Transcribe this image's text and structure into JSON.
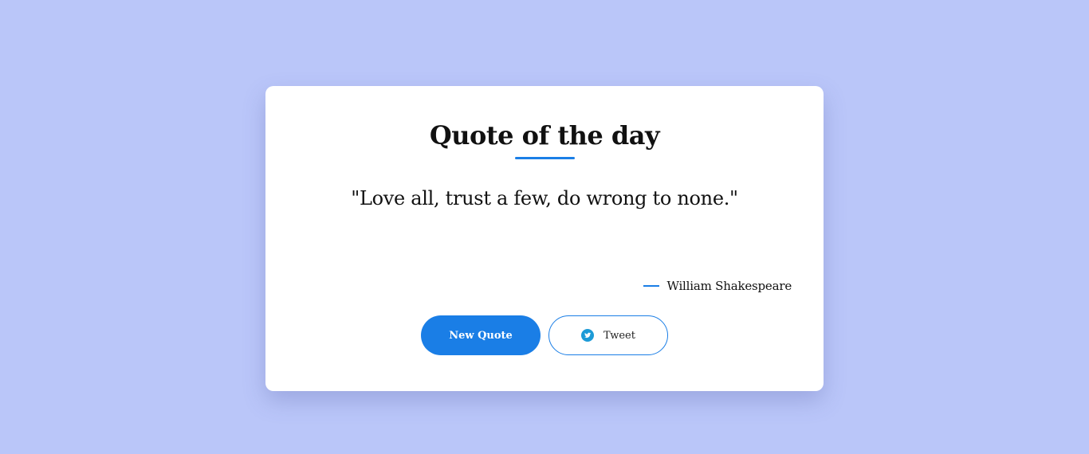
{
  "card": {
    "title": "Quote of the day",
    "quote": "\"Love all, trust a few, do wrong to none.\"",
    "author": "William Shakespeare"
  },
  "buttons": {
    "new_quote_label": "New Quote",
    "tweet_label": "Tweet",
    "tweet_icon": "twitter-icon"
  },
  "colors": {
    "background": "#bac6f9",
    "accent": "#1a7ee6",
    "card": "#ffffff"
  }
}
